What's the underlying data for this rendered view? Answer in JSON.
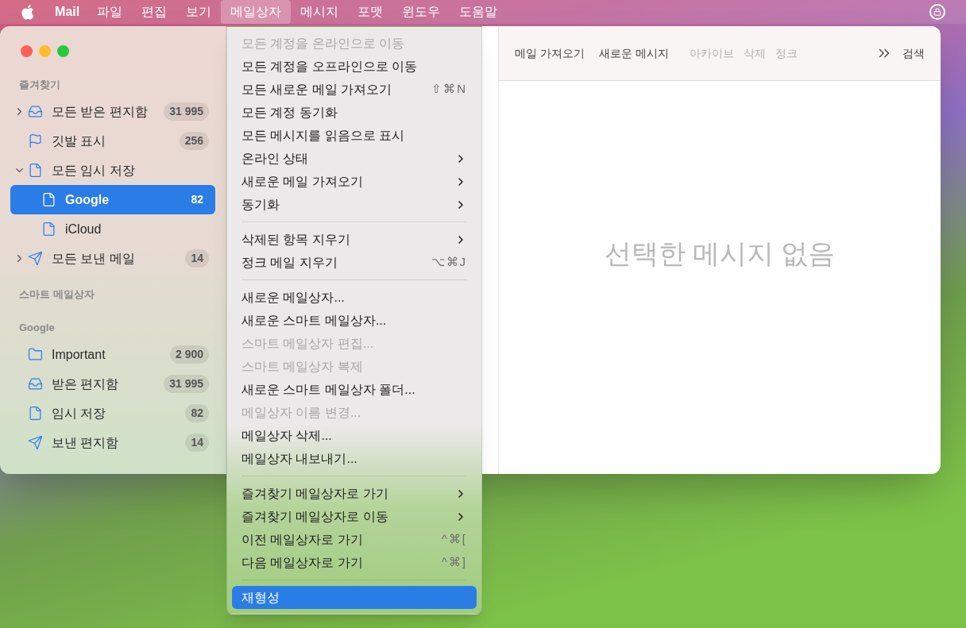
{
  "menu_bar": {
    "app": "Mail",
    "items": [
      {
        "label": "파일",
        "selected": false
      },
      {
        "label": "편집",
        "selected": false
      },
      {
        "label": "보기",
        "selected": false
      },
      {
        "label": "메일상자",
        "selected": true
      },
      {
        "label": "메시지",
        "selected": false
      },
      {
        "label": "포맷",
        "selected": false
      },
      {
        "label": "윈도우",
        "selected": false
      },
      {
        "label": "도움말",
        "selected": false
      }
    ]
  },
  "sidebar": {
    "sections": [
      {
        "title": "즐겨찾기",
        "items": [
          {
            "label": "모든 받은 편지함",
            "kind": "inbox",
            "count": "31 995",
            "expanded": false,
            "selected": false
          },
          {
            "label": "깃발 표시",
            "kind": "flag",
            "count": "256",
            "selected": false
          },
          {
            "label": "모든 임시 저장",
            "kind": "draft",
            "expanded": true,
            "selected": false,
            "children": [
              {
                "label": "Google",
                "kind": "draft",
                "count": "82",
                "selected": true
              },
              {
                "label": "iCloud",
                "kind": "draft",
                "selected": false
              }
            ]
          },
          {
            "label": "모든 보낸 메일",
            "kind": "sent",
            "count": "14",
            "expanded": false,
            "selected": false
          }
        ]
      },
      {
        "title": "스마트 메일상자"
      },
      {
        "title": "Google",
        "items": [
          {
            "label": "Important",
            "kind": "folder",
            "count": "2 900",
            "selected": false
          },
          {
            "label": "받은 편지함",
            "kind": "inbox",
            "count": "31 995",
            "selected": false
          },
          {
            "label": "임시 저장",
            "kind": "draft",
            "count": "82",
            "selected": false
          },
          {
            "label": "보낸 편지함",
            "kind": "sent",
            "count": "14",
            "selected": false
          }
        ]
      }
    ]
  },
  "toolbar": {
    "buttons": [
      {
        "label": "메일 가져오기",
        "disabled": false
      },
      {
        "label": "새로운 메시지",
        "disabled": false
      },
      {
        "label": "아카이브",
        "disabled": true
      },
      {
        "label": "삭제",
        "disabled": true
      },
      {
        "label": "정크",
        "disabled": true
      }
    ],
    "search": "검색"
  },
  "message_pane": {
    "empty_text": "선택한 메시지 없음"
  },
  "menu": {
    "items": [
      {
        "kind": "item",
        "label": "모든 계정을 온라인으로 이동",
        "disabled": true,
        "selected": false
      },
      {
        "kind": "item",
        "label": "모든 계정을 오프라인으로 이동",
        "disabled": false,
        "selected": false
      },
      {
        "kind": "item",
        "label": "모든 새로운 메일 가져오기",
        "shortcut": "⇧⌘N",
        "disabled": false,
        "selected": false
      },
      {
        "kind": "item",
        "label": "모든 계정 동기화",
        "disabled": false,
        "selected": false
      },
      {
        "kind": "item",
        "label": "모든 메시지를 읽음으로 표시",
        "disabled": false,
        "selected": false
      },
      {
        "kind": "item",
        "label": "온라인 상태",
        "submenu": true,
        "disabled": false,
        "selected": false
      },
      {
        "kind": "item",
        "label": "새로운 메일 가져오기",
        "submenu": true,
        "disabled": false,
        "selected": false
      },
      {
        "kind": "item",
        "label": "동기화",
        "submenu": true,
        "disabled": false,
        "selected": false
      },
      {
        "kind": "separator"
      },
      {
        "kind": "item",
        "label": "삭제된 항목 지우기",
        "submenu": true,
        "disabled": false,
        "selected": false
      },
      {
        "kind": "item",
        "label": "정크 메일 지우기",
        "shortcut": "⌥⌘J",
        "disabled": false,
        "selected": false
      },
      {
        "kind": "separator"
      },
      {
        "kind": "item",
        "label": "새로운 메일상자...",
        "disabled": false,
        "selected": false
      },
      {
        "kind": "item",
        "label": "새로운 스마트 메일상자...",
        "disabled": false,
        "selected": false
      },
      {
        "kind": "item",
        "label": "스마트 메일상자 편집...",
        "disabled": true,
        "selected": false
      },
      {
        "kind": "item",
        "label": "스마트 메일상자 복제",
        "disabled": true,
        "selected": false
      },
      {
        "kind": "item",
        "label": "새로운 스마트 메일상자 폴더...",
        "disabled": false,
        "selected": false
      },
      {
        "kind": "item",
        "label": "메일상자 이름 변경...",
        "disabled": true,
        "selected": false
      },
      {
        "kind": "item",
        "label": "메일상자 삭제...",
        "disabled": false,
        "selected": false
      },
      {
        "kind": "item",
        "label": "메일상자 내보내기...",
        "disabled": false,
        "selected": false
      },
      {
        "kind": "separator"
      },
      {
        "kind": "item",
        "label": "즐겨찾기 메일상자로 가기",
        "submenu": true,
        "disabled": false,
        "selected": false
      },
      {
        "kind": "item",
        "label": "즐겨찾기 메일상자로 이동",
        "submenu": true,
        "disabled": false,
        "selected": false
      },
      {
        "kind": "item",
        "label": "이전 메일상자로 가기",
        "shortcut": "^⌘[",
        "disabled": false,
        "selected": false
      },
      {
        "kind": "item",
        "label": "다음 메일상자로 가기",
        "shortcut": "^⌘]",
        "disabled": false,
        "selected": false
      },
      {
        "kind": "separator"
      },
      {
        "kind": "item",
        "label": "재형성",
        "disabled": false,
        "selected": true
      }
    ]
  }
}
